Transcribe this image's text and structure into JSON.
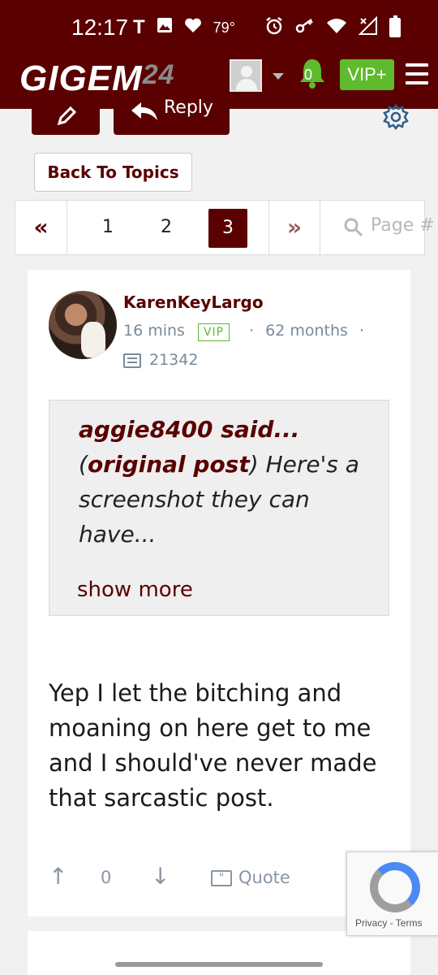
{
  "status_bar": {
    "time": "12:17",
    "carrier_icon": "T",
    "temperature": "79°",
    "icons_left": [
      "t-mobile-icon",
      "image-icon",
      "heart-icon"
    ],
    "icons_right": [
      "alarm-icon",
      "key-icon",
      "wifi-icon",
      "no-signal-icon",
      "battery-icon"
    ]
  },
  "navbar": {
    "logo_text": "GIGEM",
    "logo_number": "24",
    "notification_count": "0",
    "vip_label": "VIP+"
  },
  "toolbar": {
    "reply_label": "Reply"
  },
  "back_button": {
    "label": "Back To Topics"
  },
  "pagination": {
    "first_label": "«",
    "pages": [
      "1",
      "2",
      "3"
    ],
    "current_page": "3",
    "next_label": "»",
    "search_placeholder": "Page #"
  },
  "post": {
    "username": "KarenKeyLargo",
    "time_ago": "16 mins",
    "badge": "VIP",
    "membership": "62 months",
    "post_count": "21342",
    "quote": {
      "author": "aggie8400 said...",
      "original_link": "original post",
      "open_paren": "(",
      "close_paren": ")",
      "text": " Here's a screenshot they can have...",
      "show_more": "show more"
    },
    "body": "Yep I let the bitching and moaning on here get to me and I should've never made that sarcastic post.",
    "vote_count": "0",
    "quote_button": "Quote"
  },
  "recaptcha": {
    "privacy": "Privacy",
    "separator": " - ",
    "terms": "Terms"
  },
  "colors": {
    "brand_maroon": "#5a0001",
    "vip_green": "#5fba2c",
    "meta_gray": "#7a8a98"
  }
}
